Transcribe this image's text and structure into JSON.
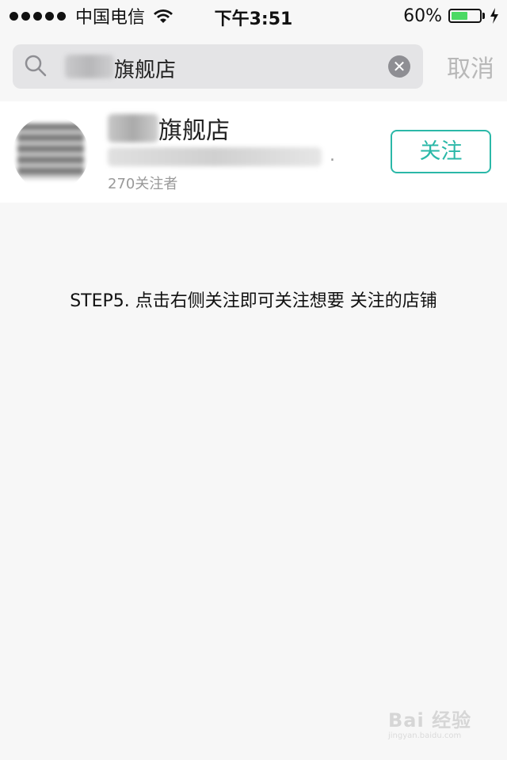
{
  "status_bar": {
    "carrier": "中国电信",
    "time": "下午3:51",
    "battery_percent": "60%",
    "battery_level": 0.6,
    "signal_dots": 5
  },
  "search": {
    "query_text": "旗舰店",
    "cancel_label": "取消"
  },
  "result": {
    "shop_name": "旗舰店",
    "followers": "270关注者",
    "follow_label": "关注",
    "follow_color": "#2bb8a8"
  },
  "instruction": "STEP5. 点击右侧关注即可关注想要 关注的店铺",
  "watermark": {
    "brand": "Bai 经验",
    "url": "jingyan.baidu.com"
  }
}
